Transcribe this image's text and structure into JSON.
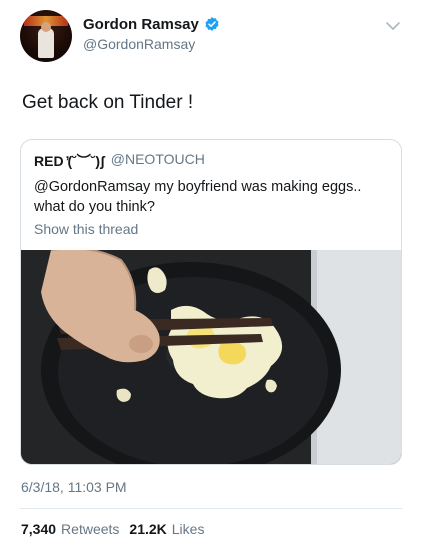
{
  "author": {
    "display_name": "Gordon Ramsay",
    "handle": "@GordonRamsay",
    "verified_color": "#1da1f2"
  },
  "tweet": {
    "text": "Get back on Tinder !",
    "timestamp": "6/3/18, 11:03 PM"
  },
  "quoted_tweet": {
    "display_name": "RED ̓(˘︶˘)ʃ",
    "handle": "@NEOTOUCH",
    "text": "@GordonRamsay my boyfriend was making eggs.. what do you think?",
    "show_thread": "Show this thread"
  },
  "stats": {
    "retweets_count": "7,340",
    "retweets_label": "Retweets",
    "likes_count": "21.2K",
    "likes_label": "Likes"
  },
  "icons": {
    "verified": "verified-badge-icon",
    "chevron": "chevron-down-icon"
  }
}
